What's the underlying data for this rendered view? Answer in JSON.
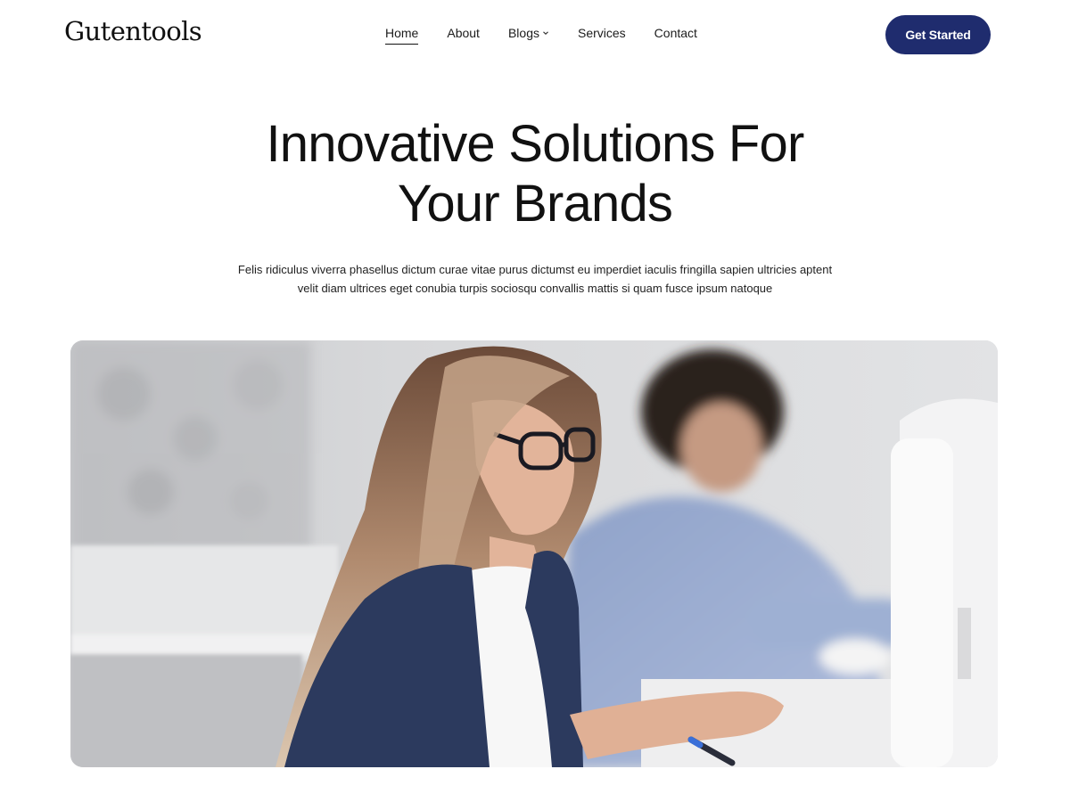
{
  "header": {
    "logo": "Gutentools",
    "nav": [
      {
        "label": "Home",
        "active": true
      },
      {
        "label": "About",
        "active": false
      },
      {
        "label": "Blogs",
        "active": false,
        "has_dropdown": true
      },
      {
        "label": "Services",
        "active": false
      },
      {
        "label": "Contact",
        "active": false
      }
    ],
    "cta_label": "Get Started"
  },
  "hero": {
    "title_line1": "Innovative Solutions For",
    "title_line2": "Your Brands",
    "subtitle_line1": "Felis ridiculus viverra phasellus dictum curae vitae purus dictumst eu imperdiet iaculis fringilla sapien ultricies aptent",
    "subtitle_line2": "velit diam ultrices eget conubia turpis sociosqu convallis mattis si quam fusce ipsum natoque"
  },
  "colors": {
    "accent": "#1f2c6e",
    "text": "#111111",
    "background": "#ffffff"
  },
  "icons": {
    "blogs_dropdown": "chevron-down-icon"
  }
}
